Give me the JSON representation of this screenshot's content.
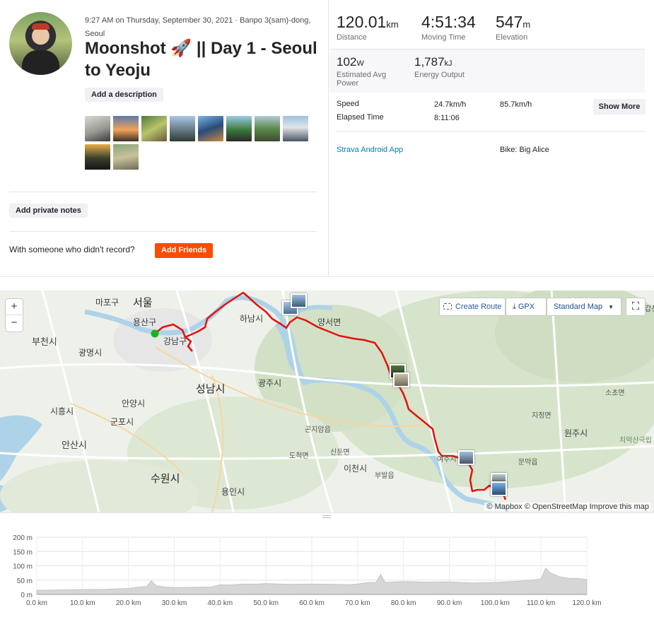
{
  "activity": {
    "meta_line1": "9:27 AM on Thursday, September 30, 2021 · Banpo 3(sam)-dong,",
    "meta_line2": "Seoul",
    "title": "Moonshot 🚀 || Day 1 - Seoul to Yeoju",
    "add_description": "Add a description",
    "add_private_notes": "Add private notes",
    "with_someone": "With someone who didn't record?",
    "add_friends": "Add Friends",
    "photos": [
      {
        "icon": "photo-thumbnail"
      },
      {
        "icon": "photo-thumbnail"
      },
      {
        "icon": "photo-thumbnail"
      },
      {
        "icon": "photo-thumbnail"
      },
      {
        "icon": "photo-thumbnail"
      },
      {
        "icon": "photo-thumbnail"
      },
      {
        "icon": "photo-thumbnail"
      },
      {
        "icon": "photo-thumbnail"
      },
      {
        "icon": "photo-thumbnail"
      },
      {
        "icon": "photo-thumbnail"
      }
    ]
  },
  "stats": {
    "distance": {
      "value": "120.01",
      "unit": "km",
      "label": "Distance"
    },
    "moving_time": {
      "value": "4:51:34",
      "label": "Moving Time"
    },
    "elevation": {
      "value": "547",
      "unit": "m",
      "label": "Elevation"
    },
    "avg_power": {
      "value": "102",
      "unit": "W",
      "label": "Estimated Avg Power"
    },
    "energy": {
      "value": "1,787",
      "unit": "kJ",
      "label": "Energy Output"
    },
    "speed": {
      "label": "Speed",
      "avg": "24.7km/h",
      "max": "85.7km/h"
    },
    "elapsed": {
      "label": "Elapsed Time",
      "value": "8:11:06"
    },
    "show_more": "Show More",
    "device": "Strava Android App",
    "bike": "Bike: Big Alice"
  },
  "map": {
    "zoom_in": "+",
    "zoom_out": "−",
    "create_route": "Create Route",
    "gpx": "GPX",
    "map_style": "Standard Map",
    "attribution": "© Mapbox © OpenStreetMap Improve this map",
    "route_color": "#e3120b",
    "start_color": "#1db31d",
    "places": {
      "mapo": "마포구",
      "seoul": "서울",
      "yongsan": "용산구",
      "gangnam": "강남구",
      "bucheon": "부천시",
      "gwangmyeong": "광명시",
      "seongnam": "성남시",
      "gwangju": "광주시",
      "anyang": "안양시",
      "siheung": "시흥시",
      "gunpo": "군포시",
      "ansan": "안산시",
      "suwon": "수원시",
      "yongin": "용인시",
      "hanam": "하남시",
      "yangseo": "양서면",
      "gonjiam": "곤지암읍",
      "docheok": "도척면",
      "sindun": "신둔면",
      "icheon": "이천시",
      "bubal": "부발읍",
      "yeoju": "여주시",
      "jijeong": "지정면",
      "sochon": "소초면",
      "wonju": "원주시",
      "munmak": "문막읍",
      "chiak": "치악산국립",
      "gapcheon": "갑천"
    }
  },
  "chart_data": {
    "type": "area",
    "xlabel": "",
    "ylabel": "",
    "x_ticks": [
      "0.0 km",
      "10.0 km",
      "20.0 km",
      "30.0 km",
      "40.0 km",
      "50.0 km",
      "60.0 km",
      "70.0 km",
      "80.0 km",
      "90.0 km",
      "100.0 km",
      "110.0 km",
      "120.0 km"
    ],
    "y_ticks": [
      "0 m",
      "50 m",
      "100 m",
      "150 m",
      "200 m"
    ],
    "xlim": [
      0,
      120
    ],
    "ylim": [
      0,
      200
    ],
    "grid": true,
    "series": [
      {
        "x": [
          0,
          5,
          10,
          15,
          20,
          22,
          24,
          25,
          26,
          28,
          30,
          35,
          38,
          40,
          42,
          45,
          48,
          50,
          55,
          60,
          65,
          68,
          70,
          72,
          74,
          75,
          76,
          78,
          80,
          85,
          90,
          95,
          100,
          105,
          108,
          110,
          111,
          112,
          114,
          116,
          118,
          120
        ],
        "y": [
          14,
          16,
          17,
          18,
          21,
          25,
          28,
          48,
          30,
          26,
          24,
          25,
          26,
          34,
          33,
          36,
          36,
          38,
          35,
          36,
          35,
          34,
          36,
          41,
          42,
          70,
          42,
          44,
          45,
          43,
          44,
          40,
          42,
          46,
          50,
          54,
          92,
          76,
          62,
          56,
          56,
          52
        ]
      }
    ]
  }
}
